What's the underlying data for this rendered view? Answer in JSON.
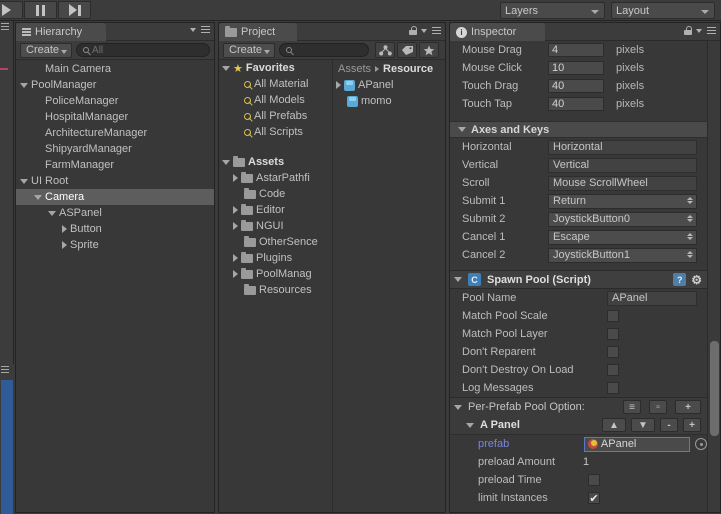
{
  "toolbar": {
    "play_icon": "play-icon",
    "pause_icon": "pause-icon",
    "step_icon": "step-icon",
    "layers_label": "Layers",
    "layout_label": "Layout"
  },
  "hierarchy": {
    "tab_label": "Hierarchy",
    "create_label": "Create",
    "search_value": "All",
    "items": [
      {
        "label": "Main Camera",
        "indent": 1,
        "caret": "none",
        "selected": false
      },
      {
        "label": "PoolManager",
        "indent": 0,
        "caret": "down",
        "selected": false
      },
      {
        "label": "PoliceManager",
        "indent": 1,
        "caret": "none",
        "selected": false
      },
      {
        "label": "HospitalManager",
        "indent": 1,
        "caret": "none",
        "selected": false
      },
      {
        "label": "ArchitectureManager",
        "indent": 1,
        "caret": "none",
        "selected": false
      },
      {
        "label": "ShipyardManager",
        "indent": 1,
        "caret": "none",
        "selected": false
      },
      {
        "label": "FarmManager",
        "indent": 1,
        "caret": "none",
        "selected": false
      },
      {
        "label": "UI Root",
        "indent": 0,
        "caret": "down",
        "selected": false
      },
      {
        "label": "Camera",
        "indent": 1,
        "caret": "down",
        "selected": true
      },
      {
        "label": "ASPanel",
        "indent": 2,
        "caret": "down",
        "selected": false
      },
      {
        "label": "Button",
        "indent": 3,
        "caret": "right",
        "selected": false
      },
      {
        "label": "Sprite",
        "indent": 3,
        "caret": "right",
        "selected": false
      }
    ]
  },
  "project": {
    "tab_label": "Project",
    "create_label": "Create",
    "search_placeholder": "",
    "icon_buttons": [
      "object-filter-icon",
      "label-filter-icon",
      "favorite-star-icon"
    ],
    "favorites_label": "Favorites",
    "favorites": [
      {
        "label": "All Material"
      },
      {
        "label": "All Models"
      },
      {
        "label": "All Prefabs"
      },
      {
        "label": "All Scripts"
      }
    ],
    "assets_label": "Assets",
    "assets": [
      {
        "label": "AstarPathfi",
        "caret": "right",
        "selected": false
      },
      {
        "label": "Code",
        "caret": "none",
        "selected": false
      },
      {
        "label": "Editor",
        "caret": "right",
        "selected": false
      },
      {
        "label": "NGUI",
        "caret": "right",
        "selected": false
      },
      {
        "label": "OtherSence",
        "caret": "none",
        "selected": false
      },
      {
        "label": "Plugins",
        "caret": "right",
        "selected": false
      },
      {
        "label": "PoolManag",
        "caret": "right",
        "selected": false
      },
      {
        "label": "Resources",
        "caret": "none",
        "selected": true
      }
    ],
    "breadcrumb": {
      "root": "Assets",
      "current": "Resource"
    },
    "files": [
      {
        "label": "APanel",
        "selected": true,
        "caret": "right"
      },
      {
        "label": "momo",
        "selected": false,
        "caret": "none"
      }
    ]
  },
  "inspector": {
    "tab_label": "Inspector",
    "lock_icon": "lock-icon",
    "menu_icon": "hamburger-icon",
    "threshold_rows": [
      {
        "label": "Mouse Drag",
        "value": "4",
        "unit": "pixels"
      },
      {
        "label": "Mouse Click",
        "value": "10",
        "unit": "pixels"
      },
      {
        "label": "Touch Drag",
        "value": "40",
        "unit": "pixels"
      },
      {
        "label": "Touch Tap",
        "value": "40",
        "unit": "pixels"
      }
    ],
    "axes_section_title": "Axes and Keys",
    "axes_rows": [
      {
        "label": "Horizontal",
        "value": "Horizontal",
        "kind": "text"
      },
      {
        "label": "Vertical",
        "value": "Vertical",
        "kind": "text"
      },
      {
        "label": "Scroll",
        "value": "Mouse ScrollWheel",
        "kind": "text"
      },
      {
        "label": "Submit 1",
        "value": "Return",
        "kind": "popup"
      },
      {
        "label": "Submit 2",
        "value": "JoystickButton0",
        "kind": "popup"
      },
      {
        "label": "Cancel 1",
        "value": "Escape",
        "kind": "popup"
      },
      {
        "label": "Cancel 2",
        "value": "JoystickButton1",
        "kind": "popup"
      }
    ],
    "spawn_pool": {
      "title": "Spawn Pool (Script)",
      "script_icon": "script-icon",
      "help_icon": "help-icon",
      "gear_icon": "gear-icon",
      "pool_name_label": "Pool Name",
      "pool_name_value": "APanel",
      "toggles": [
        {
          "label": "Match Pool Scale",
          "checked": false
        },
        {
          "label": "Match Pool Layer",
          "checked": false
        },
        {
          "label": "Don't Reparent",
          "checked": false
        },
        {
          "label": "Don't Destroy On Load",
          "checked": false
        },
        {
          "label": "Log Messages",
          "checked": false
        }
      ]
    },
    "per_prefab": {
      "title": "Per-Prefab Pool Option:",
      "buttons": [
        "list-icon",
        "duplicate-icon",
        "add-icon"
      ],
      "entry_title": "A Panel",
      "entry_buttons": [
        "move-up-icon",
        "move-down-icon",
        "remove-icon",
        "add-icon"
      ],
      "prefab_label": "prefab",
      "prefab_value": "APanel",
      "preload_amount_label": "preload Amount",
      "preload_amount_value": "1",
      "preload_time_label": "preload Time",
      "preload_time_checked": false,
      "limit_instances_label": "limit Instances",
      "limit_instances_checked": true
    }
  }
}
